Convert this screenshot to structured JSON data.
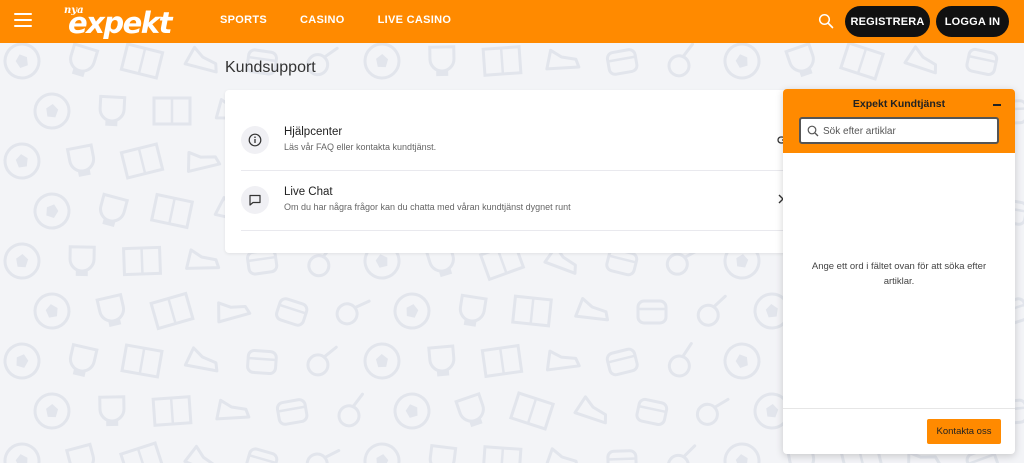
{
  "header": {
    "logo_prefix": "nya",
    "logo_text": "expekt",
    "nav": [
      {
        "label": "SPORTS"
      },
      {
        "label": "CASINO"
      },
      {
        "label": "LIVE CASINO"
      }
    ],
    "register_label": "REGISTRERA",
    "login_label": "LOGGA IN"
  },
  "page": {
    "title": "Kundsupport",
    "items": [
      {
        "title": "Hjälpcenter",
        "subtitle": "Läs vår FAQ eller kontakta kundtjänst.",
        "icon": "info-icon"
      },
      {
        "title": "Live Chat",
        "subtitle": "Om du har några frågor kan du chatta med våran kundtjänst dygnet runt",
        "icon": "chat-icon"
      }
    ]
  },
  "widget": {
    "title": "Expekt Kundtjänst",
    "search_placeholder": "Sök efter artiklar",
    "message": "Ange ett ord i fältet ovan för att söka efter artiklar.",
    "contact_label": "Kontakta oss"
  },
  "colors": {
    "brand": "#ff8a00",
    "dark": "#111111",
    "background": "#f3f4f7"
  }
}
